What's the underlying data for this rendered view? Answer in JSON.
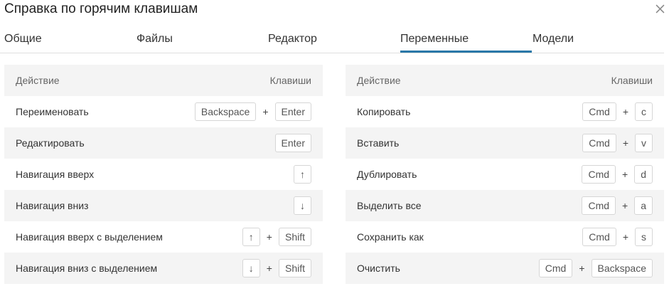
{
  "dialog": {
    "title": "Справка по горячим клавишам",
    "tabs": [
      "Общие",
      "Файлы",
      "Редактор",
      "Переменные",
      "Модели"
    ],
    "active_tab": "Переменные"
  },
  "left_table": {
    "header": {
      "action": "Действие",
      "keys": "Клавиши"
    },
    "rows": [
      {
        "action": "Переименовать",
        "keys": [
          "Backspace",
          "Enter"
        ]
      },
      {
        "action": "Редактировать",
        "keys": [
          "Enter"
        ]
      },
      {
        "action": "Навигация вверх",
        "keys": [
          "↑"
        ]
      },
      {
        "action": "Навигация вниз",
        "keys": [
          "↓"
        ]
      },
      {
        "action": "Навигация вверх с выделением",
        "keys": [
          "↑",
          "Shift"
        ]
      },
      {
        "action": "Навигация вниз с выделением",
        "keys": [
          "↓",
          "Shift"
        ]
      }
    ]
  },
  "right_table": {
    "header": {
      "action": "Действие",
      "keys": "Клавиши"
    },
    "rows": [
      {
        "action": "Копировать",
        "keys": [
          "Cmd",
          "c"
        ]
      },
      {
        "action": "Вставить",
        "keys": [
          "Cmd",
          "v"
        ]
      },
      {
        "action": "Дублировать",
        "keys": [
          "Cmd",
          "d"
        ]
      },
      {
        "action": "Выделить все",
        "keys": [
          "Cmd",
          "a"
        ]
      },
      {
        "action": "Сохранить как",
        "keys": [
          "Cmd",
          "s"
        ]
      },
      {
        "action": "Очистить",
        "keys": [
          "Cmd",
          "Backspace"
        ]
      }
    ]
  },
  "key_separator": "+",
  "icons": {
    "close": "close-icon"
  }
}
